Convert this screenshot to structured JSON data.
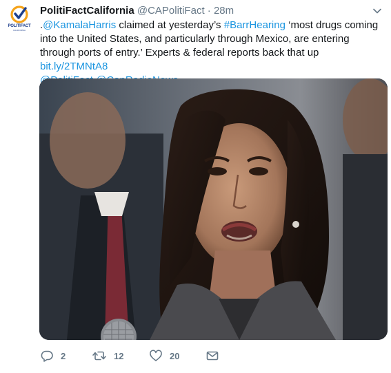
{
  "tweet": {
    "display_name": "PolitiFactCalifornia",
    "screen_name": "@CAPolitiFact",
    "separator": "·",
    "time": "28m",
    "text_prefix": ".",
    "mention_1": "@KamalaHarris",
    "text_1": " claimed at yesterday’s ",
    "hashtag_1": "#BarrHearing",
    "text_2": " ‘most drugs coming into the United States, and particularly through Mexico, are entering through ports of entry.’ Experts & federal reports back that up ",
    "link_1": "bit.ly/2TMNtA8",
    "mention_2": "@PolitiFact",
    "mention_3": "@CapRadioNews"
  },
  "avatar": {
    "logo_text": "POLITIFACT",
    "logo_sub": "CALIFORNIA"
  },
  "actions": {
    "reply_count": "2",
    "retweet_count": "12",
    "like_count": "20"
  },
  "colors": {
    "link": "#1b95e0",
    "muted": "#657786",
    "text": "#14171a",
    "logo_orange": "#f5a31a",
    "logo_blue": "#1d3f8c"
  },
  "icons": {
    "caret": "chevron-down-icon",
    "reply": "reply-icon",
    "retweet": "retweet-icon",
    "like": "heart-icon",
    "dm": "envelope-icon"
  }
}
